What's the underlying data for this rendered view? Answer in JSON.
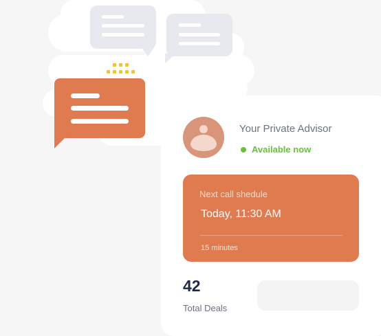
{
  "advisor": {
    "title": "Your Private Advisor",
    "status": "Available now",
    "status_color": "#67c23a",
    "avatar_icon": "user-avatar-icon"
  },
  "call": {
    "label": "Next call shedule",
    "time": "Today, 11:30 AM",
    "duration": "15 minutes",
    "accent": "#e07b4f"
  },
  "deals": {
    "count": "42",
    "label": "Total Deals"
  },
  "icons": {
    "chat_bubble_left": "chat-bubble-icon",
    "chat_bubble_right": "chat-bubble-icon",
    "chat_bubble_orange": "chat-bubble-icon",
    "typing_dots": "typing-dots-icon"
  }
}
